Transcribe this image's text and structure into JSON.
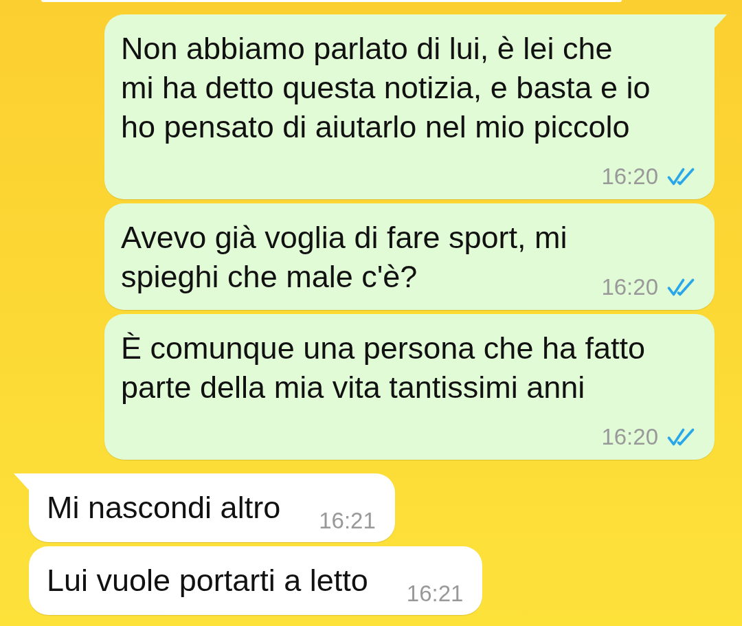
{
  "messages": [
    {
      "kind": "sent",
      "tail": true,
      "text": "Non abbiamo parlato di lui, è lei che\nmi ha detto questa notizia, e basta e io\nho pensato di aiutarlo nel mio piccolo",
      "time": "16:20",
      "read": true
    },
    {
      "kind": "sent",
      "tail": false,
      "text": "Avevo già voglia di fare sport, mi\nspieghi che male c'è?",
      "time": "16:20",
      "read": true
    },
    {
      "kind": "sent",
      "tail": false,
      "text": "È comunque una persona che ha fatto\nparte della mia vita tantissimi anni",
      "time": "16:20",
      "read": true
    },
    {
      "kind": "received",
      "tail": true,
      "text": "Mi nascondi altro",
      "time": "16:21"
    },
    {
      "kind": "received",
      "tail": false,
      "text": "Lui vuole portarti a letto",
      "time": "16:21"
    }
  ]
}
